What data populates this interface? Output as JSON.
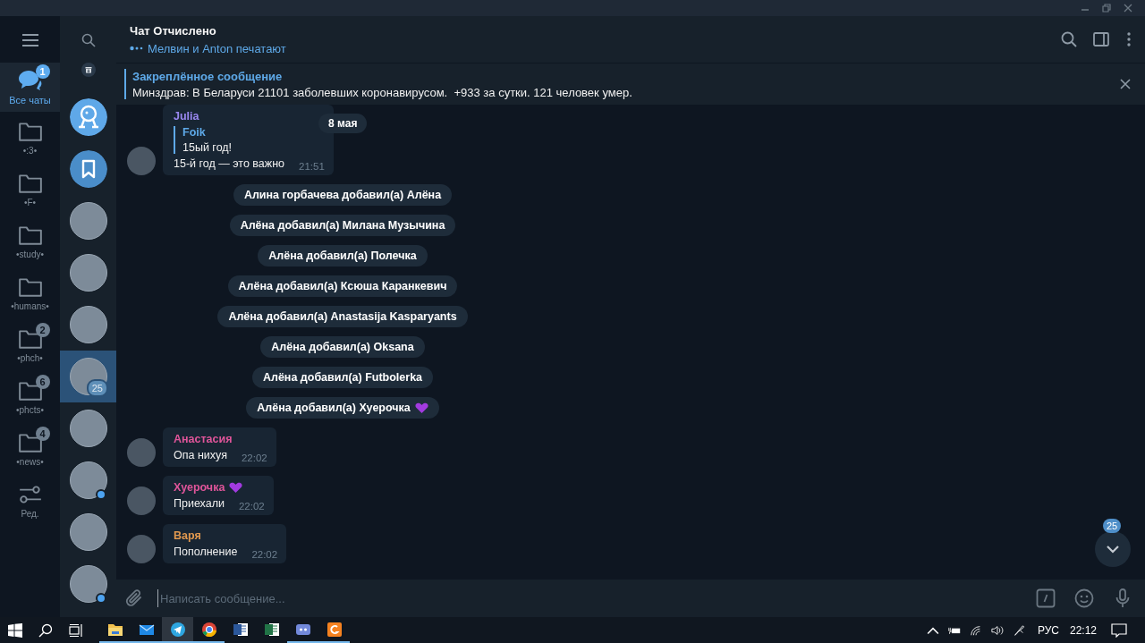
{
  "folders": [
    {
      "kind": "all",
      "label": "Все чаты",
      "badge": "1",
      "selected": true
    },
    {
      "kind": "folder",
      "label": "•:3•",
      "selected": false
    },
    {
      "kind": "folder",
      "label": "•F•",
      "selected": false
    },
    {
      "kind": "folder",
      "label": "•study•",
      "selected": false
    },
    {
      "kind": "folder",
      "label": "•humans•",
      "selected": false
    },
    {
      "kind": "folder",
      "label": "•phch•",
      "badge": "2",
      "selected": false
    },
    {
      "kind": "folder",
      "label": "•phcts•",
      "badge": "6",
      "selected": false
    },
    {
      "kind": "folder",
      "label": "•news•",
      "badge": "4",
      "selected": false
    },
    {
      "kind": "edit",
      "label": "Ред.",
      "selected": false
    }
  ],
  "chats": [
    {
      "kind": "archive",
      "selected": false,
      "online": false
    },
    {
      "kind": "bot",
      "selected": false,
      "online": false
    },
    {
      "kind": "saved",
      "selected": false,
      "online": false
    },
    {
      "kind": "photo",
      "selected": false,
      "online": false
    },
    {
      "kind": "photo",
      "selected": false,
      "online": false
    },
    {
      "kind": "photo",
      "selected": false,
      "online": false
    },
    {
      "kind": "photo",
      "selected": true,
      "online": false,
      "badge": "25"
    },
    {
      "kind": "photo",
      "selected": false,
      "online": false
    },
    {
      "kind": "photo",
      "selected": false,
      "online": true
    },
    {
      "kind": "photo",
      "selected": false,
      "online": false
    },
    {
      "kind": "photo",
      "selected": false,
      "online": true
    }
  ],
  "header": {
    "title": "Чат Отчислено",
    "status": "Мелвин и Anton печатают"
  },
  "pinned": {
    "title": "Закреплённое сообщение",
    "text": "Минздрав: В Беларуси 21101 заболевших коронавирусом.  +933 за сутки. 121 человек умер."
  },
  "date_badge": "8 мая",
  "messages": [
    {
      "kind": "message",
      "name": "Julia",
      "color": "#9a88f0",
      "heart": false,
      "reply": {
        "name": "Foik",
        "text": "15ый год!"
      },
      "text": "15-й год — это важно",
      "time": "21:51"
    },
    {
      "kind": "service",
      "text": "Алина горбачева добавил(а) Алёна",
      "heart": false
    },
    {
      "kind": "service",
      "text": "Алёна добавил(а) Милана Музычина",
      "heart": false
    },
    {
      "kind": "service",
      "text": "Алёна добавил(а) Полечка",
      "heart": false
    },
    {
      "kind": "service",
      "text": "Алёна добавил(а) Ксюша Каранкевич",
      "heart": false
    },
    {
      "kind": "service",
      "text": "Алёна добавил(а) Anastasija Kasparyants",
      "heart": false
    },
    {
      "kind": "service",
      "text": "Алёна добавил(а) Oksana",
      "heart": false
    },
    {
      "kind": "service",
      "text": "Алёна добавил(а) Futbolerka",
      "heart": false
    },
    {
      "kind": "service",
      "text": "Алёна добавил(а) Хуерочка",
      "heart": true
    },
    {
      "kind": "message",
      "name": "Анастасия",
      "color": "#e0559a",
      "heart": false,
      "text": "Опа нихуя",
      "time": "22:02"
    },
    {
      "kind": "message",
      "name": "Хуерочка",
      "color": "#e0559a",
      "heart": true,
      "text": "Приехали",
      "time": "22:02"
    },
    {
      "kind": "message",
      "name": "Варя",
      "color": "#e0984f",
      "heart": false,
      "text": "Пополнение",
      "time": "22:02"
    }
  ],
  "scroll_down": {
    "badge": "25"
  },
  "input": {
    "placeholder": "Написать сообщение..."
  },
  "taskbar": {
    "apps": [
      {
        "kind": "explorer",
        "running": true,
        "active": false
      },
      {
        "kind": "mail",
        "running": true,
        "active": false
      },
      {
        "kind": "telegram",
        "running": true,
        "active": true
      },
      {
        "kind": "chrome",
        "running": true,
        "active": false
      },
      {
        "kind": "word",
        "running": false,
        "active": false
      },
      {
        "kind": "excel",
        "running": false,
        "active": false
      },
      {
        "kind": "discord",
        "running": true,
        "active": false
      },
      {
        "kind": "other",
        "running": true,
        "active": false
      }
    ],
    "language": "РУС",
    "time": "22:12"
  }
}
